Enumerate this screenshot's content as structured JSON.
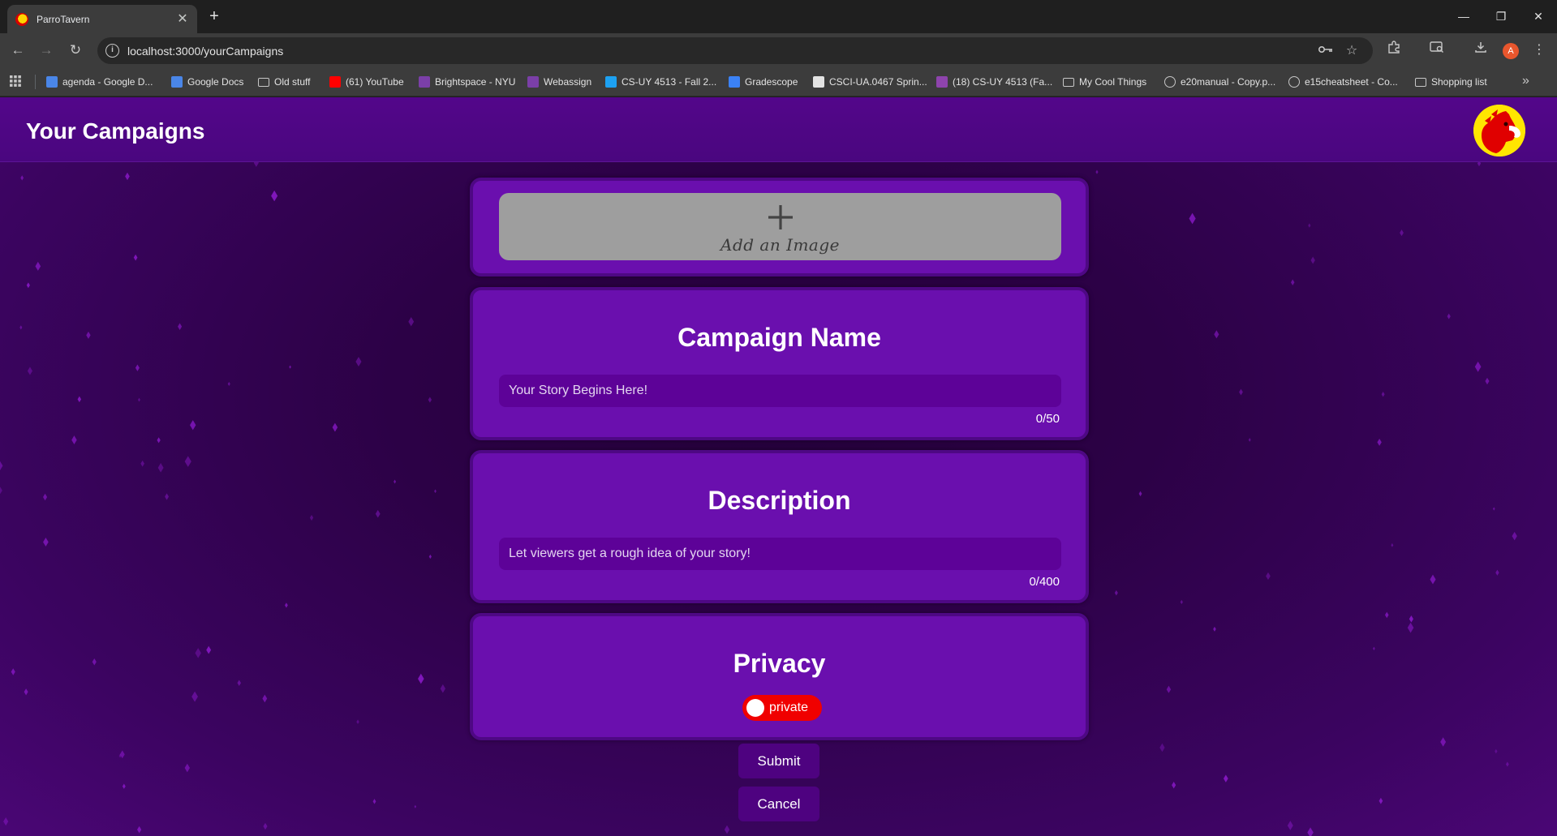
{
  "browser": {
    "tab_title": "ParroTavern",
    "tab_close": "✕",
    "new_tab": "+",
    "window_controls": {
      "minimize": "—",
      "restore": "❐",
      "close": "✕"
    },
    "nav": {
      "back": "←",
      "forward": "→",
      "reload": "↻"
    },
    "url": "localhost:3000/yourCampaigns",
    "profile_initial": "A",
    "bookmarks": [
      {
        "label": "agenda - Google D...",
        "icon": "google-docs-icon",
        "color": "#4a86e8"
      },
      {
        "label": "Google Docs",
        "icon": "google-docs-icon",
        "color": "#4a86e8"
      },
      {
        "label": "Old stuff",
        "icon": "folder-icon",
        "color": "folder"
      },
      {
        "label": "(61) YouTube",
        "icon": "youtube-icon",
        "color": "#ff0000"
      },
      {
        "label": "Brightspace - NYU",
        "icon": "nyu-icon",
        "color": "#7b3fa8"
      },
      {
        "label": "Webassign",
        "icon": "nyu-icon",
        "color": "#7b3fa8"
      },
      {
        "label": "CS-UY 4513 - Fall 2...",
        "icon": "zoom-icon",
        "color": "#1da1f2"
      },
      {
        "label": "Gradescope",
        "icon": "gradescope-icon",
        "color": "#3b82f6"
      },
      {
        "label": "CSCI-UA.0467 Sprin...",
        "icon": "nyu-icon",
        "color": "#e3e3e3"
      },
      {
        "label": "(18) CS-UY 4513 (Fa...",
        "icon": "ed-icon",
        "color": "#8e44ad"
      },
      {
        "label": "My Cool Things",
        "icon": "folder-icon",
        "color": "folder"
      },
      {
        "label": "e20manual - Copy.p...",
        "icon": "globe-icon",
        "color": "globe"
      },
      {
        "label": "e15cheatsheet - Co...",
        "icon": "globe-icon",
        "color": "globe"
      },
      {
        "label": "Shopping list",
        "icon": "folder-icon",
        "color": "folder"
      }
    ]
  },
  "app": {
    "title": "Your Campaigns",
    "logo": "parrot-logo",
    "add_image_label": "Add an Image",
    "name_heading": "Campaign Name",
    "name_placeholder": "Your Story Begins Here!",
    "name_count": "0/50",
    "desc_heading": "Description",
    "desc_placeholder": "Let viewers get a rough idea of your story!",
    "desc_count": "0/400",
    "privacy_heading": "Privacy",
    "privacy_toggle_label": "private",
    "submit_label": "Submit",
    "cancel_label": "Cancel"
  },
  "colors": {
    "header": "#4a067f",
    "card": "#6a0fae",
    "input": "#5d0298",
    "toggle_private": "#f00000",
    "button": "#4e0280",
    "star": "#8a19c8"
  }
}
